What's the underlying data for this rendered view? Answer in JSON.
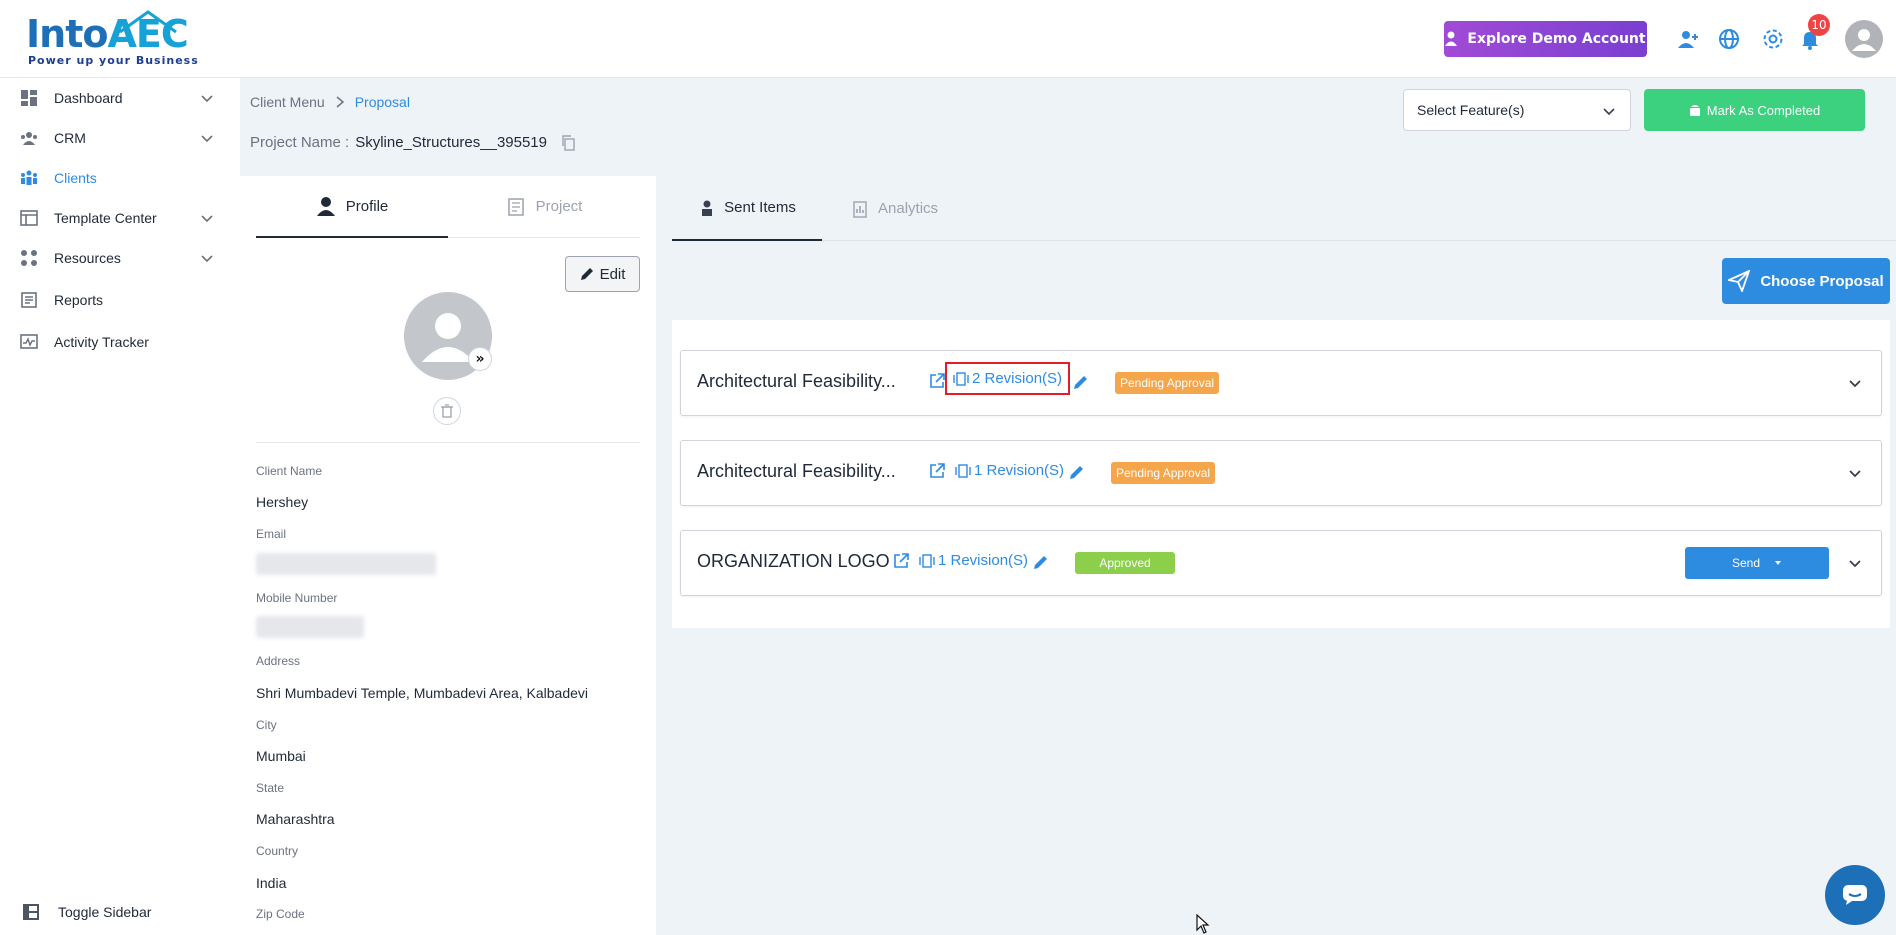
{
  "app": {
    "logo_text_main": "Into",
    "logo_text_accent": "AEC",
    "logo_tagline": "Power up your Business"
  },
  "topbar": {
    "explore_label": "Explore Demo Account",
    "notification_count": "10"
  },
  "sidebar": {
    "items": [
      {
        "label": "Dashboard",
        "icon": "dashboard-icon",
        "expandable": true
      },
      {
        "label": "CRM",
        "icon": "crm-icon",
        "expandable": true
      },
      {
        "label": "Clients",
        "icon": "clients-icon",
        "expandable": false,
        "active": true
      },
      {
        "label": "Template Center",
        "icon": "template-icon",
        "expandable": true
      },
      {
        "label": "Resources",
        "icon": "resources-icon",
        "expandable": true
      },
      {
        "label": "Reports",
        "icon": "reports-icon",
        "expandable": false
      },
      {
        "label": "Activity Tracker",
        "icon": "activity-icon",
        "expandable": false
      }
    ],
    "toggle_label": "Toggle Sidebar"
  },
  "breadcrumb": {
    "parent": "Client Menu",
    "current": "Proposal"
  },
  "project": {
    "label": "Project Name :",
    "name": "Skyline_Structures__395519"
  },
  "header_actions": {
    "select_features": "Select Feature(s)",
    "mark_completed": "Mark As Completed"
  },
  "profile_panel": {
    "tabs": [
      {
        "label": "Profile",
        "active": true
      },
      {
        "label": "Project",
        "active": false
      }
    ],
    "edit_label": "Edit",
    "fields": {
      "client_name_label": "Client Name",
      "client_name": "Hershey",
      "email_label": "Email",
      "mobile_label": "Mobile Number",
      "address_label": "Address",
      "address": "Shri Mumbadevi Temple, Mumbadevi Area, Kalbadevi",
      "city_label": "City",
      "city": "Mumbai",
      "state_label": "State",
      "state": "Maharashtra",
      "country_label": "Country",
      "country": "India",
      "zip_label": "Zip Code"
    }
  },
  "right_panel": {
    "tabs": [
      {
        "label": "Sent Items",
        "active": true
      },
      {
        "label": "Analytics",
        "active": false
      }
    ],
    "choose_label": "Choose Proposal",
    "proposals": [
      {
        "title": "Architectural Feasibility...",
        "revisions": "2 Revision(S)",
        "status": "Pending Approval"
      },
      {
        "title": "Architectural Feasibility...",
        "revisions": "1 Revision(S)",
        "status": "Pending Approval"
      },
      {
        "title": "ORGANIZATION LOGO",
        "revisions": "1 Revision(S)",
        "status": "Approved",
        "send_label": "Send"
      }
    ]
  },
  "colors": {
    "accent": "#2e8ce0",
    "success": "#3bd17f",
    "pending": "#f5a54a",
    "approved": "#8bcf4a",
    "highlight": "#e11d2a"
  }
}
